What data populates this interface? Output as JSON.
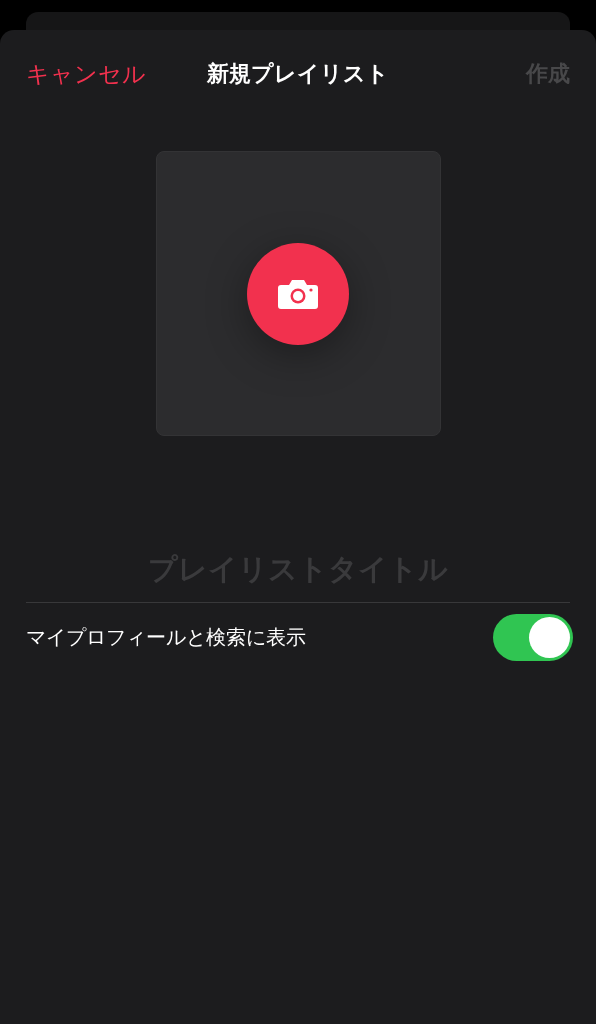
{
  "nav": {
    "cancel": "キャンセル",
    "title": "新規プレイリスト",
    "create": {
      "label": "作成",
      "disabled": true
    }
  },
  "artwork": {
    "kind": "empty"
  },
  "title_field": {
    "placeholder": "プレイリストタイトル"
  },
  "toggle": {
    "label": "マイプロフィールと検索に表示",
    "on": true
  }
}
